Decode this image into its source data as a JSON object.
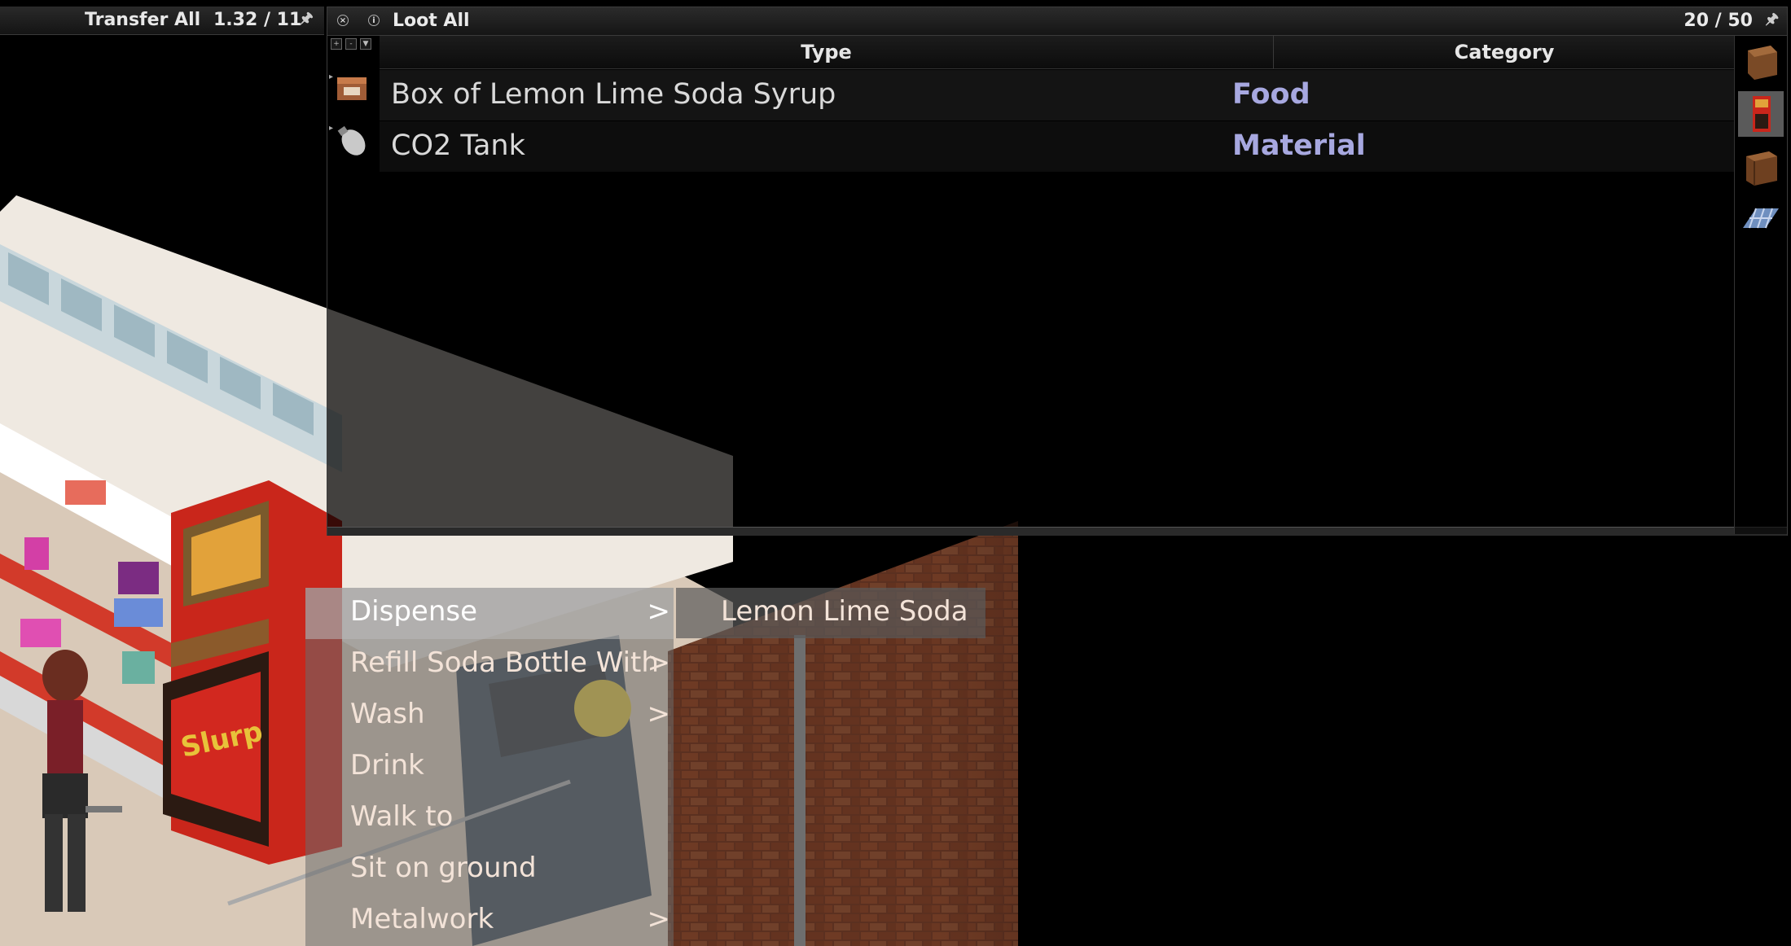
{
  "inventory_header": {
    "transfer_all_label": "Transfer All",
    "weight": "1.32 / 11",
    "pin_icon": "pin-icon"
  },
  "loot_window": {
    "close_icon": "close-icon",
    "info_icon": "info-icon",
    "loot_all_label": "Loot All",
    "weight": "20 / 50",
    "pin_icon": "pin-icon",
    "columns": {
      "type": "Type",
      "category": "Category"
    },
    "items": [
      {
        "name": "Box of Lemon Lime Soda Syrup",
        "category": "Food",
        "icon": "box-icon"
      },
      {
        "name": "CO2 Tank",
        "category": "Material",
        "icon": "gas-tank-icon"
      }
    ],
    "containers": [
      {
        "icon": "crate-icon",
        "active": false
      },
      {
        "icon": "soda-dispenser-icon",
        "active": true
      },
      {
        "icon": "cabinet-icon",
        "active": false
      },
      {
        "icon": "floor-icon",
        "active": false
      }
    ]
  },
  "context_menu": {
    "items": [
      {
        "label": "Dispense",
        "arrow": ">",
        "highlighted": true
      },
      {
        "label": "Refill Soda Bottle With",
        "arrow": ">",
        "highlighted": false
      },
      {
        "label": "Wash",
        "arrow": ">",
        "highlighted": false
      },
      {
        "label": "Drink",
        "arrow": "",
        "highlighted": false
      },
      {
        "label": "Walk to",
        "arrow": "",
        "highlighted": false
      },
      {
        "label": "Sit on ground",
        "arrow": "",
        "highlighted": false
      },
      {
        "label": "Metalwork",
        "arrow": ">",
        "highlighted": false
      }
    ],
    "submenu": {
      "items": [
        {
          "label": "Lemon Lime Soda"
        }
      ]
    }
  },
  "colors": {
    "category_text": "#a7a8e0",
    "menu_text": "#f3e3d8",
    "menu_highlight": "#b9b9b9"
  }
}
